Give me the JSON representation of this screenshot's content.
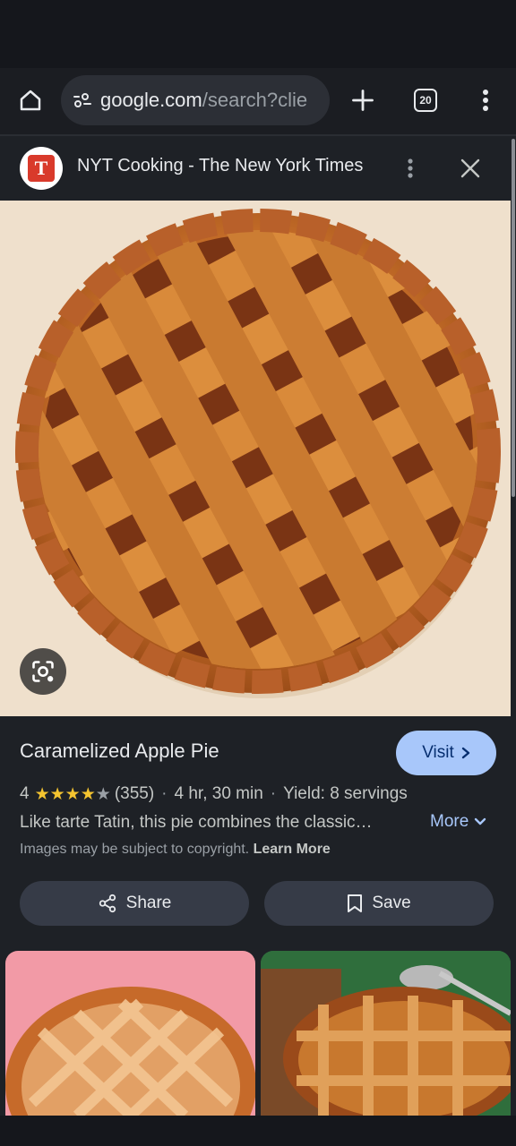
{
  "browser": {
    "url_domain": "google.com",
    "url_path": "/search?clie",
    "tab_count": "20"
  },
  "source": {
    "title": "NYT Cooking - The New York Times",
    "logo_letter": "T"
  },
  "recipe": {
    "title": "Caramelized Apple Pie",
    "rating_value": "4",
    "rating_stars": 4,
    "rating_max": 5,
    "review_count": "(355)",
    "time": "4 hr, 30 min",
    "yield": "Yield: 8 servings",
    "description": "Like tarte Tatin, this pie combines the classic…",
    "more_label": "More",
    "visit_label": "Visit",
    "copyright_text": "Images may be subject to copyright.",
    "learn_more": "Learn More"
  },
  "actions": {
    "share_label": "Share",
    "save_label": "Save"
  },
  "colors": {
    "accent": "#a8c7fa",
    "star": "#f4c430",
    "star_empty": "#9aa0a6",
    "panel_bg": "#1e2126",
    "nyt_red": "#d93a2b"
  },
  "icons": [
    "home-icon",
    "site-info-icon",
    "new-tab-icon",
    "tab-switcher-icon",
    "overflow-menu-icon",
    "nyt-logo-icon",
    "more-vert-icon",
    "close-icon",
    "lens-icon",
    "chevron-right-icon",
    "chevron-down-icon",
    "share-icon",
    "bookmark-icon"
  ]
}
